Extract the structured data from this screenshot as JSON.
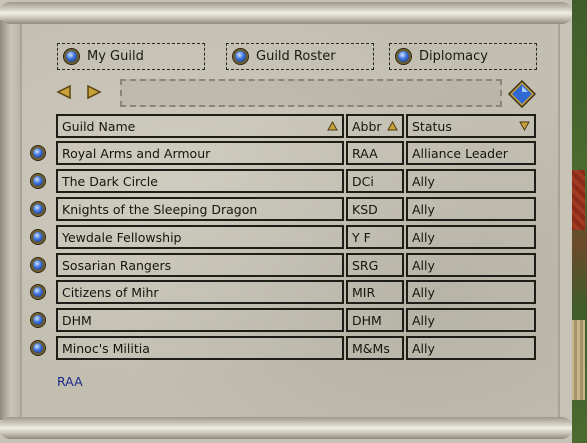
{
  "tabs": {
    "my_guild": "My Guild",
    "guild_roster": "Guild Roster",
    "diplomacy": "Diplomacy"
  },
  "table": {
    "headers": {
      "name": "Guild Name",
      "abbr": "Abbr",
      "status": "Status"
    },
    "rows": [
      {
        "name": "Royal Arms and Armour",
        "abbr": "RAA",
        "status": "Alliance Leader"
      },
      {
        "name": "The Dark Circle",
        "abbr": "DCi",
        "status": "Ally"
      },
      {
        "name": "Knights of the Sleeping Dragon",
        "abbr": "KSD",
        "status": "Ally"
      },
      {
        "name": "Yewdale Fellowship",
        "abbr": "Y F",
        "status": "Ally"
      },
      {
        "name": "Sosarian Rangers",
        "abbr": "SRG",
        "status": "Ally"
      },
      {
        "name": "Citizens of Mihr",
        "abbr": "MIR",
        "status": "Ally"
      },
      {
        "name": "DHM",
        "abbr": "DHM",
        "status": "Ally"
      },
      {
        "name": "Minoc's Militia",
        "abbr": "M&Ms",
        "status": "Ally"
      }
    ]
  },
  "footer": {
    "selected_abbr": "RAA"
  },
  "icons": {
    "tab_button": "blue-gem-icon",
    "prev": "arrow-left-icon",
    "next": "arrow-right-icon",
    "search": "blue-diamond-icon",
    "sort_asc": "triangle-up-icon",
    "sort_desc": "triangle-down-icon",
    "row_select": "blue-gem-icon"
  },
  "colors": {
    "parchment": "#c2beb0",
    "text": "#15150f",
    "footer_text": "#1a2a8a",
    "arrow_gold": "#c9a23a",
    "gem_blue": "#3a6fd8"
  }
}
